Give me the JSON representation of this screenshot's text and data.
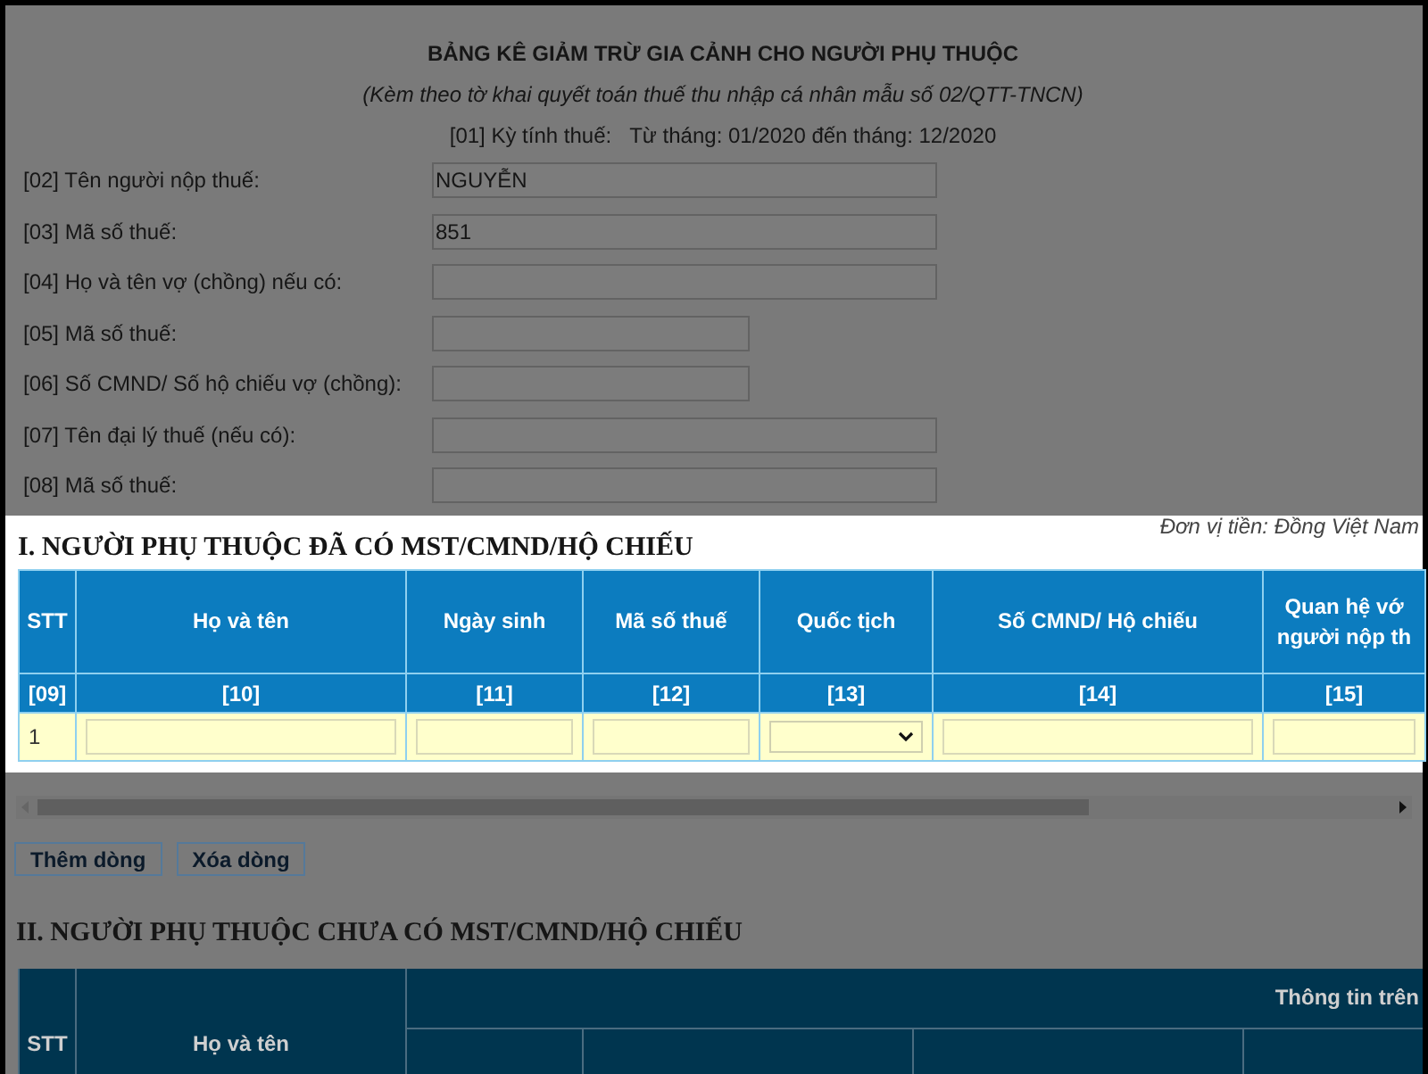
{
  "header": {
    "title": "BẢNG KÊ GIẢM TRỪ GIA CẢNH CHO NGƯỜI PHỤ THUỘC",
    "subtitle": "(Kèm theo tờ khai quyết toán thuế thu nhập cá nhân mẫu số 02/QTT-TNCN)",
    "period_label": "[01] Kỳ tính thuế:",
    "period_value": "Từ tháng: 01/2020 đến tháng: 12/2020"
  },
  "fields": [
    {
      "label": "[02] Tên người nộp thuế:",
      "value": "NGUYỄN",
      "kind": "long"
    },
    {
      "label": "[03] Mã số thuế:",
      "value": "851",
      "kind": "long"
    },
    {
      "label": "[04] Họ và tên vợ (chồng) nếu có:",
      "kind": "long"
    },
    {
      "label": "[05] Mã số thuế:",
      "kind": "short"
    },
    {
      "label": "[06] Số CMND/ Số hộ chiếu vợ (chồng):",
      "kind": "short"
    },
    {
      "label": "[07] Tên đại lý thuế (nếu có):",
      "kind": "long"
    },
    {
      "label": "[08] Mã số thuế:",
      "kind": "long"
    }
  ],
  "currency_note": "Đơn vị tiền: Đồng Việt Nam",
  "section1": {
    "title": "I. NGƯỜI PHỤ THUỘC ĐÃ CÓ MST/CMND/HỘ CHIẾU",
    "columns": [
      {
        "label": "STT",
        "code": "[09]"
      },
      {
        "label": "Họ và tên",
        "code": "[10]"
      },
      {
        "label": "Ngày sinh",
        "code": "[11]"
      },
      {
        "label": "Mã số thuế",
        "code": "[12]"
      },
      {
        "label": "Quốc tịch",
        "code": "[13]"
      },
      {
        "label": "Số CMND/ Hộ chiếu",
        "code": "[14]"
      },
      {
        "label": "Quan hệ vớ\nngười nộp th",
        "code": "[15]"
      }
    ],
    "rows": [
      {
        "stt": "1",
        "cells": [
          {
            "kind": "input"
          },
          {
            "kind": "input"
          },
          {
            "kind": "input"
          },
          {
            "kind": "select"
          },
          {
            "kind": "input"
          },
          {
            "kind": "input"
          }
        ]
      }
    ]
  },
  "buttons": [
    "Thêm dòng",
    "Xóa dòng"
  ],
  "section2": {
    "title": "II. NGƯỜI PHỤ THUỘC CHƯA CÓ MST/CMND/HỘ CHIẾU",
    "columns": [
      "STT",
      "Họ và tên"
    ],
    "group_header": "Thông tin trên"
  }
}
